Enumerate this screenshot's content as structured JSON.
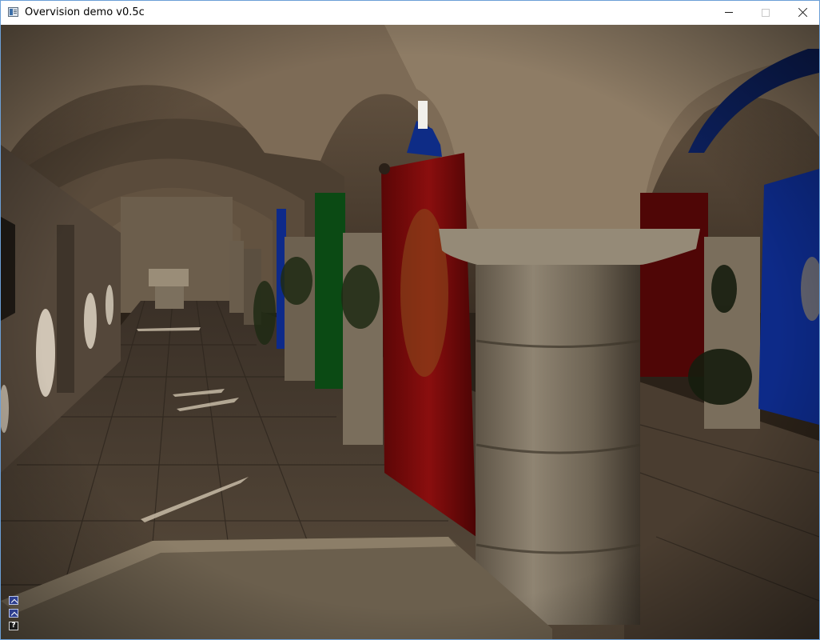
{
  "window": {
    "title": "Overvision demo v0.5c",
    "controls": {
      "minimize": "minimize-icon",
      "maximize": "maximize-icon",
      "close": "close-icon"
    }
  },
  "overlay": {
    "buttons": [
      {
        "icon": "chevron-up-icon"
      },
      {
        "icon": "chevron-up-icon"
      },
      {
        "icon": "help-icon",
        "label": "?"
      }
    ]
  },
  "colors": {
    "banner_red": "#7a0a0a",
    "banner_blue": "#0f2a7a",
    "banner_green": "#0b4a14",
    "stone": "#8a7a66",
    "floor": "#4e4234"
  }
}
